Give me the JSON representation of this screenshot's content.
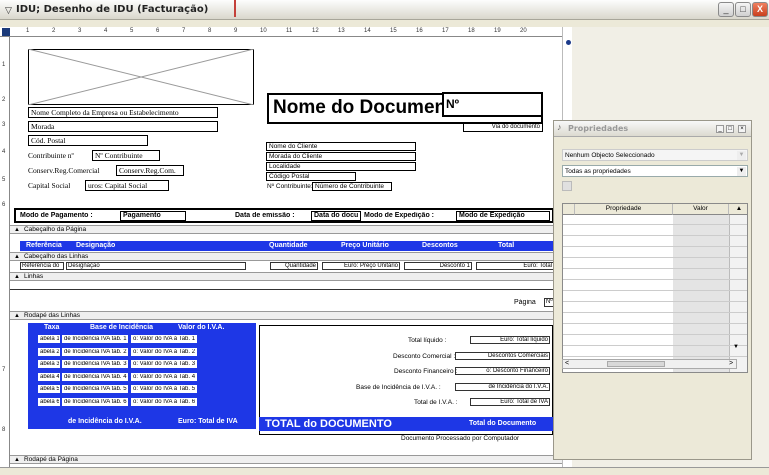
{
  "window": {
    "title": "IDU; Desenho de IDU (Facturação)",
    "min_glyph": "_",
    "max_glyph": "□",
    "close_glyph": "X"
  },
  "ruler": {
    "h_ticks": [
      "1",
      "2",
      "3",
      "4",
      "5",
      "6",
      "7",
      "8",
      "9",
      "10",
      "11",
      "12",
      "13",
      "14",
      "15",
      "16",
      "17",
      "18",
      "19",
      "20"
    ],
    "v_ticks": [
      "1",
      "2",
      "3",
      "4",
      "5",
      "6",
      "7",
      "8"
    ]
  },
  "report": {
    "title": "Nome do Documento",
    "numero": "Nº",
    "via": "Via do documento",
    "empresa_nome": "Nome Completo da Empresa ou Estabelecimento",
    "morada": "Morada",
    "cod_postal": "Cód. Postal",
    "contribuinte_label": "Contribuinte nº",
    "contribuinte_value": "Nº Contribuinte",
    "conserv_label": "Conserv.Reg.Comercial",
    "conserv_value": "Conserv.Reg.Com.",
    "capital_label": "Capital Social",
    "capital_value": "uros: Capital Social",
    "cliente_nome": "Nome do Cliente",
    "cliente_morada": "Morada do Cliente",
    "cliente_localidade": "Localidade",
    "cliente_cp": "Código Postal",
    "cliente_contrib_label": "Nº Contribuinte:",
    "cliente_contrib_value": "Número de Contribuinte",
    "pagamento_label": "Modo de Pagamento :",
    "pagamento_value": "Pagamento",
    "emissao_label": "Data de emissão :",
    "emissao_value": "Data do docu",
    "expedicao_label": "Modo de Expedição :",
    "expedicao_value": "Modo de Expedição"
  },
  "bands": {
    "cabecalho_pagina": "Cabeçalho da Página",
    "cabecalho_linhas": "Cabeçalho das Linhas",
    "linhas": "Linhas",
    "rodape_linhas": "Rodapé das Linhas",
    "rodape_pagina": "Rodapé da Página",
    "arrow": "▲"
  },
  "lines_header": {
    "referencia": "Referência",
    "designacao": "Designação",
    "quantidade": "Quantidade",
    "preco": "Preço Unitário",
    "descontos": "Descontos",
    "total": "Total"
  },
  "lines_fields": {
    "referencia": "Referência do",
    "designacao": "Designação",
    "quantidade": "Quantidade",
    "preco": "Euro: Preço Unitário",
    "desconto": "Desconto 1",
    "total": "Euro: Total"
  },
  "pagina_label": "Página",
  "pagina_value": "Nº",
  "iva": {
    "headers": {
      "taxa": "Taxa",
      "base": "Base de Incidência",
      "valor": "Valor do I.V.A."
    },
    "rows": [
      {
        "taxa": "abela 1",
        "base": "de Incidência IVA tab. 1",
        "valor": "o: Valor do IVA à Tab. 1"
      },
      {
        "taxa": "abela 2",
        "base": "de Incidência IVA tab. 2",
        "valor": "o: Valor do IVA à Tab. 2"
      },
      {
        "taxa": "abela 3",
        "base": "de Incidência IVA tab. 3",
        "valor": "o: Valor do IVA à Tab. 3"
      },
      {
        "taxa": "abela 4",
        "base": "de Incidência IVA tab. 4",
        "valor": "o: Valor do IVA à Tab. 4"
      },
      {
        "taxa": "abela 5",
        "base": "de Incidência IVA tab. 5",
        "valor": "o: Valor do IVA à Tab. 5"
      },
      {
        "taxa": "abela 6",
        "base": "de Incidência IVA tab. 6",
        "valor": "o: Valor do IVA à Tab. 6"
      }
    ],
    "footer_base": "de Incidência do I.V.A.",
    "footer_total": "Euro: Total de IVA"
  },
  "totals": {
    "liquido_label": "Total líquido :",
    "liquido_value": "Euro: Total líquido",
    "comercial_label": "Desconto Comercial :",
    "comercial_value": "Descontos Comerciais",
    "financeiro_label": "Desconto Financeiro :",
    "financeiro_value": "o: Desconto Financeiro",
    "base_label": "Base de Incidência de I.V.A. :",
    "base_value": "de Incidência do I.V.A.",
    "iva_label": "Total de I.V.A. :",
    "iva_value": "Euro: Total de IVA",
    "documento_label": "TOTAL do DOCUMENTO",
    "documento_value": "Total do Documento",
    "processado": "Documento Processado por Computador"
  },
  "properties": {
    "title": "Propriedades",
    "selection": "Nenhum Objecto Seleccionado",
    "filter": "Todas as propriedades",
    "col_prop": "Propriedade",
    "col_valor": "Valor",
    "btn_min": "_",
    "btn_max": "□",
    "btn_close": "×",
    "scroll_left": "<",
    "scroll_right": ">",
    "scroll_up": "▲",
    "scroll_down": "▼",
    "dropdown": "▼"
  },
  "icons": {
    "window": "▽",
    "properties": "♪"
  }
}
